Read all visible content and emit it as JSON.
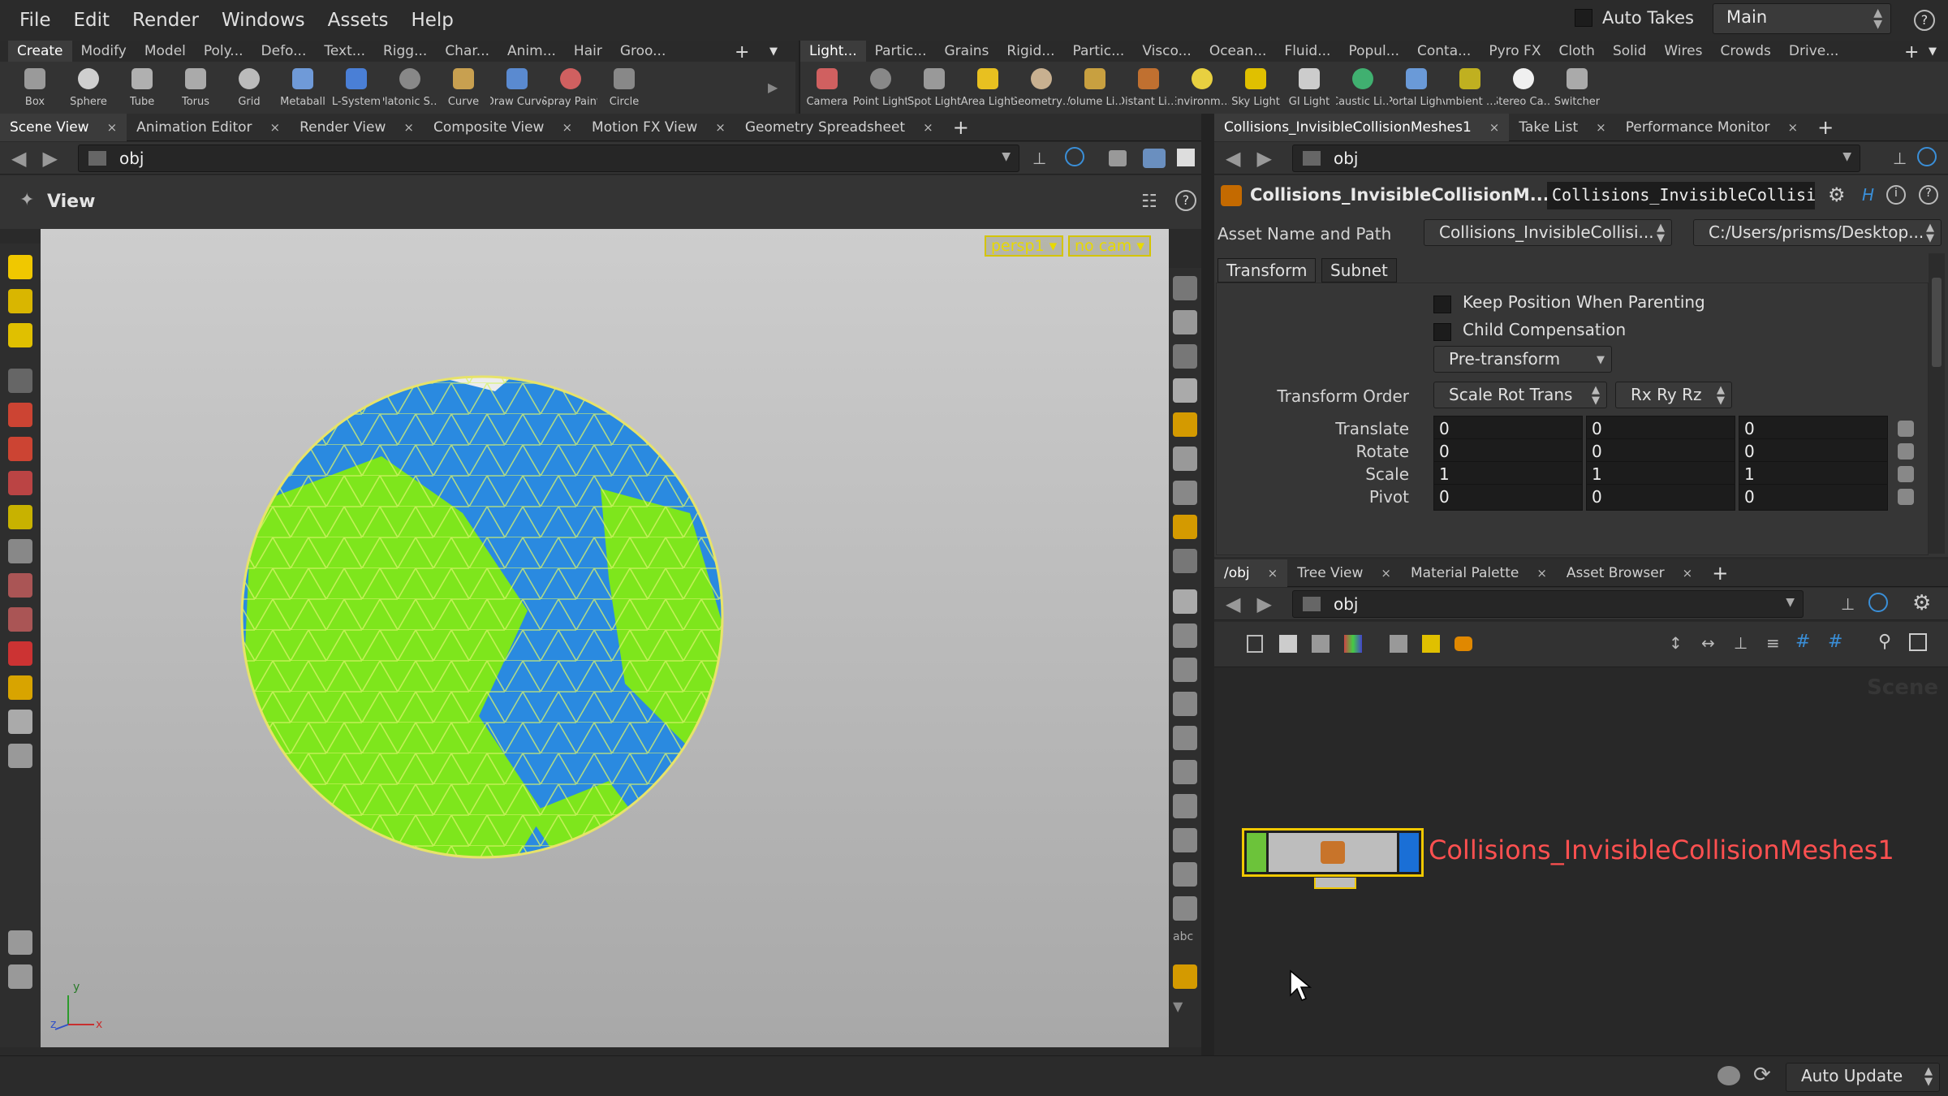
{
  "menu": [
    "File",
    "Edit",
    "Render",
    "Windows",
    "Assets",
    "Help"
  ],
  "auto_takes_label": "Auto Takes",
  "take_value": "Main",
  "left_shelf": {
    "tabs": [
      "Create",
      "Modify",
      "Model",
      "Poly...",
      "Defo...",
      "Text...",
      "Rigg...",
      "Char...",
      "Anim...",
      "Hair",
      "Groo..."
    ],
    "tools": [
      {
        "label": "Box",
        "icon": "box-icon"
      },
      {
        "label": "Sphere",
        "icon": "sphere-icon"
      },
      {
        "label": "Tube",
        "icon": "tube-icon"
      },
      {
        "label": "Torus",
        "icon": "torus-icon"
      },
      {
        "label": "Grid",
        "icon": "grid-icon"
      },
      {
        "label": "Metaball",
        "icon": "metaball-icon"
      },
      {
        "label": "L-System",
        "icon": "lsystem-icon"
      },
      {
        "label": "Platonic Sol...",
        "icon": "platonic-icon"
      },
      {
        "label": "Curve",
        "icon": "curve-icon"
      },
      {
        "label": "Draw Curve",
        "icon": "draw-curve-icon"
      },
      {
        "label": "Spray Paint",
        "icon": "spray-paint-icon"
      },
      {
        "label": "Circle",
        "icon": "circle-icon"
      }
    ]
  },
  "right_shelf": {
    "tabs": [
      "Light...",
      "Partic...",
      "Grains",
      "Rigid...",
      "Partic...",
      "Visco...",
      "Ocean...",
      "Fluid...",
      "Popul...",
      "Conta...",
      "Pyro FX",
      "Cloth",
      "Solid",
      "Wires",
      "Crowds",
      "Drive..."
    ],
    "tools": [
      {
        "label": "Camera",
        "icon": "camera-icon"
      },
      {
        "label": "Point Light",
        "icon": "point-light-icon"
      },
      {
        "label": "Spot Light",
        "icon": "spot-light-icon"
      },
      {
        "label": "Area Light",
        "icon": "area-light-icon"
      },
      {
        "label": "Geometry L...",
        "icon": "geometry-light-icon"
      },
      {
        "label": "Volume Light",
        "icon": "volume-light-icon"
      },
      {
        "label": "Distant Light",
        "icon": "distant-light-icon"
      },
      {
        "label": "Environme...",
        "icon": "environment-light-icon"
      },
      {
        "label": "Sky Light",
        "icon": "sky-light-icon"
      },
      {
        "label": "GI Light",
        "icon": "gi-light-icon"
      },
      {
        "label": "Caustic Light",
        "icon": "caustic-light-icon"
      },
      {
        "label": "Portal Light",
        "icon": "portal-light-icon"
      },
      {
        "label": "Ambient Li...",
        "icon": "ambient-light-icon"
      },
      {
        "label": "Stereo Cam...",
        "icon": "stereo-camera-icon"
      },
      {
        "label": "Switcher",
        "icon": "switcher-icon"
      }
    ]
  },
  "left_pane": {
    "tabs": [
      "Scene View",
      "Animation Editor",
      "Render View",
      "Composite View",
      "Motion FX View",
      "Geometry Spreadsheet"
    ],
    "path": "obj",
    "view_title": "View",
    "persp_label": "persp1",
    "cam_label": "no cam",
    "axes": {
      "y": "y",
      "z": "z",
      "x": "x"
    }
  },
  "param_pane": {
    "tabs": [
      "Collisions_InvisibleCollisionMeshes1",
      "Take List",
      "Performance Monitor"
    ],
    "path": "obj",
    "node_type": "Collisions_InvisibleCollisionM...",
    "node_name": "Collisions_InvisibleCollisi",
    "asset_label": "Asset Name and Path",
    "asset_name": "Collisions_InvisibleCollisi...",
    "asset_path": "C:/Users/prisms/Desktop...",
    "sub_tabs": [
      "Transform",
      "Subnet"
    ],
    "keep_position": "Keep Position When Parenting",
    "child_comp": "Child Compensation",
    "pre_transform": "Pre-transform",
    "transform_order_label": "Transform Order",
    "transform_order": "Scale Rot Trans",
    "rot_order": "Rx Ry Rz",
    "rows": [
      {
        "label": "Translate",
        "values": [
          "0",
          "0",
          "0"
        ]
      },
      {
        "label": "Rotate",
        "values": [
          "0",
          "0",
          "0"
        ]
      },
      {
        "label": "Scale",
        "values": [
          "1",
          "1",
          "1"
        ]
      },
      {
        "label": "Pivot",
        "values": [
          "0",
          "0",
          "0"
        ]
      }
    ]
  },
  "network_pane": {
    "tabs": [
      "/obj",
      "Tree View",
      "Material Palette",
      "Asset Browser"
    ],
    "path": "obj",
    "watermark": "Scene",
    "node_label": "Collisions_InvisibleCollisionMeshes1"
  },
  "status": {
    "auto_update": "Auto Update"
  },
  "colors": {
    "accent_yellow": "#f0c800",
    "node_label": "#ff5050",
    "sphere_blue": "#2d8fe0",
    "sphere_green": "#7fe61c"
  }
}
